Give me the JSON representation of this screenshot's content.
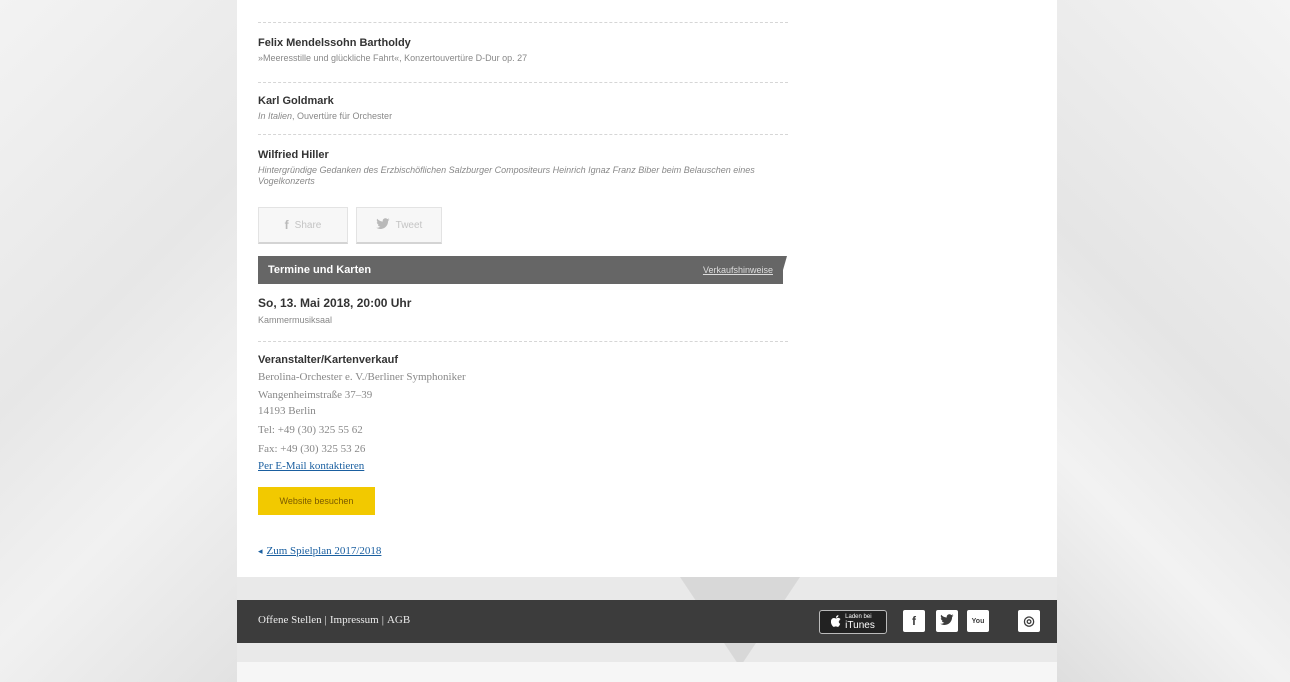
{
  "works": [
    {
      "composer": "Felix Mendelssohn Bartholdy",
      "title": "»Meeresstille und glückliche Fahrt«, Konzertouvertüre D-Dur op. 27"
    },
    {
      "composer": "Karl Goldmark",
      "title_italic": "In Italien",
      "title": ", Ouvertüre für Orchester"
    },
    {
      "composer": "Wilfried Hiller",
      "title_italic": "Hintergründige Gedanken des Erzbischöflichen Salzburger Compositeurs Heinrich Ignaz Franz Biber beim Belauschen eines Vogelkonzerts"
    }
  ],
  "share": {
    "facebook_label": "Share",
    "twitter_label": "Tweet"
  },
  "tickets": {
    "header": "Termine und Karten",
    "sales_link": "Verkaufshinweise",
    "date": "So, 13. Mai 2018, 20:00 Uhr",
    "venue": "Kammermusiksaal"
  },
  "organizer": {
    "heading": "Veranstalter/Kartenverkauf",
    "name": "Berolina-Orchester e. V./Berliner Symphoniker",
    "street": "Wangenheimstraße 37–39",
    "city": "14193 Berlin",
    "tel": "Tel: +49 (30) 325 55 62",
    "fax": "Fax: +49 (30) 325 53 26",
    "email_link": "Per E-Mail kontaktieren",
    "website_button": "Website besuchen"
  },
  "back_link": "Zum Spielplan 2017/2018",
  "footer": {
    "links": [
      "Offene Stellen",
      "Impressum",
      "AGB"
    ],
    "separator": "|",
    "itunes_small": "Laden bei",
    "itunes_label": "iTunes"
  },
  "icons": {
    "facebook": "f",
    "twitter": "t",
    "youtube": "You",
    "instagram": "◎",
    "apple": "",
    "chevron": "◂"
  }
}
